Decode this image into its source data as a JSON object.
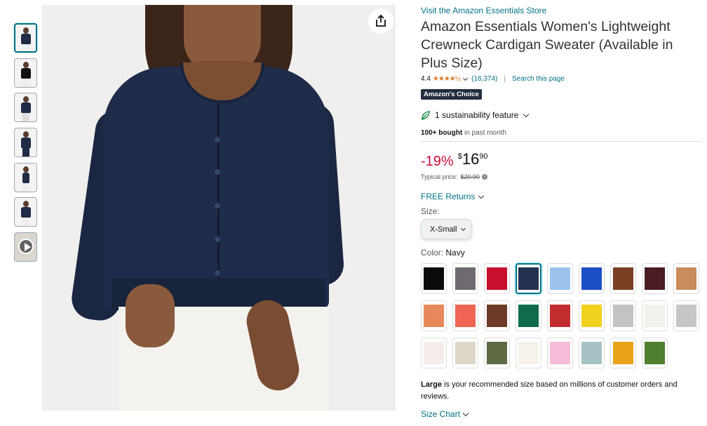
{
  "gallery": {
    "thumbnail_count": 7,
    "selected_index": 0,
    "share_icon": "share-icon"
  },
  "product": {
    "store_link": "Visit the Amazon Essentials Store",
    "title": "Amazon Essentials Women's Lightweight Crewneck Cardigan Sweater (Available in Plus Size)",
    "rating": "4.4",
    "stars_display": "★★★★½",
    "review_count": "(16,374)",
    "search_page": "Search this page",
    "badge_prefix": "Amazon's",
    "badge_suffix": "Choice",
    "sustainability": "1 sustainability feature",
    "bought_bold": "100+ bought",
    "bought_rest": " in past month",
    "discount": "-19%",
    "currency": "$",
    "price_whole": "16",
    "price_fraction": "90",
    "typical_label": "Typical price:",
    "typical_price": "$20.90",
    "returns": "FREE Returns",
    "size_label": "Size:",
    "size_selected": "X-Small",
    "color_label": "Color:",
    "color_selected": "Navy",
    "recommend_bold": "Large",
    "recommend_rest": " is your recommended size based on millions of customer orders and reviews.",
    "size_chart": "Size Chart"
  },
  "colors": {
    "accent_link": "#007185",
    "discount": "#cc0c39",
    "star": "#de7921",
    "swatches": [
      [
        "#0b0b0b",
        "#6e6a70",
        "#c8102e",
        "#24324f",
        "#9cc3ee",
        "#1d4fc4",
        "#7a3f22",
        "#4a1d25",
        "#c98c5c"
      ],
      [
        "#e8895b",
        "#f06454",
        "#6d3a28",
        "#0f6b4b",
        "#c42d30",
        "#f0d21e",
        "#c3c3c3",
        "#f2f1ed",
        "#c6c6c8"
      ],
      [
        "#f5eceb",
        "#ddd7ca",
        "#5d6a43",
        "#f6f2ea",
        "#f4bcd7",
        "#a6c2c4",
        "#eaa21b",
        "#4e7f2e"
      ]
    ],
    "selected_swatch": [
      0,
      3
    ]
  }
}
